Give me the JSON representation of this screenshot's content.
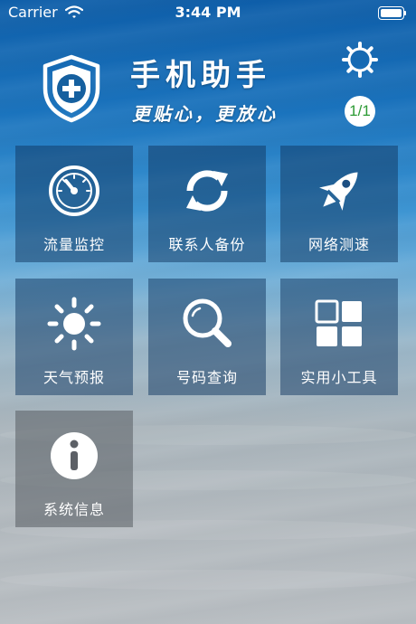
{
  "status_bar": {
    "carrier": "Carrier",
    "time": "3:44 PM"
  },
  "header": {
    "title": "手机助手",
    "slogan": "更贴心，更放心",
    "page_indicator": "1/1"
  },
  "colors": {
    "badge_text": "#2e9b36",
    "tile_blue": "#103660",
    "tile_gray": "#585c62"
  },
  "tiles": [
    {
      "label": "流量监控",
      "icon": "speedometer-icon"
    },
    {
      "label": "联系人备份",
      "icon": "sync-icon"
    },
    {
      "label": "网络测速",
      "icon": "rocket-icon"
    },
    {
      "label": "天气预报",
      "icon": "sun-icon"
    },
    {
      "label": "号码查询",
      "icon": "magnifier-icon"
    },
    {
      "label": "实用小工具",
      "icon": "grid-icon"
    },
    {
      "label": "系统信息",
      "icon": "info-icon"
    }
  ]
}
